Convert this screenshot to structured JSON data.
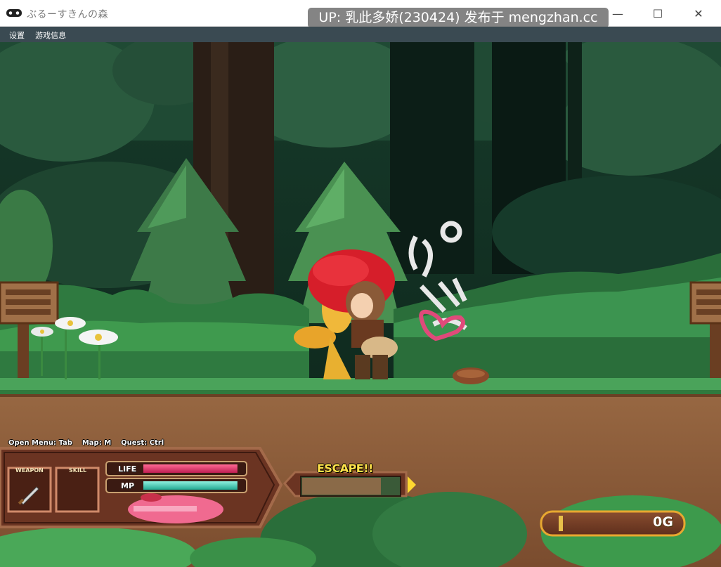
{
  "window": {
    "title": "ぶるーすきんの森",
    "watermark": "UP: 乳此多娇(230424) 发布于 mengzhan.cc",
    "controls": {
      "minimize": "—",
      "maximize": "☐",
      "close": "✕"
    }
  },
  "menu": {
    "items": [
      "设置",
      "游戏信息"
    ]
  },
  "hud": {
    "controls_hint": "Open Menu: Tab    Map: M    Quest: Ctrl",
    "weapon_label": "WEAPON",
    "skill_label": "SKILL",
    "life_label": "LIFE",
    "mp_label": "MP",
    "life_fraction": 0.97,
    "mp_fraction": 0.97,
    "escape_label": "ESCAPE!!",
    "escape_fraction": 0.8,
    "gold": "0G"
  },
  "scene": {
    "sfx_text": "パンッ",
    "colors": {
      "life": "#e0306a",
      "mp": "#3fcfb8",
      "panel": "#6b3422",
      "ground": "#8a5a38",
      "grass": "#3f9a4e"
    }
  }
}
